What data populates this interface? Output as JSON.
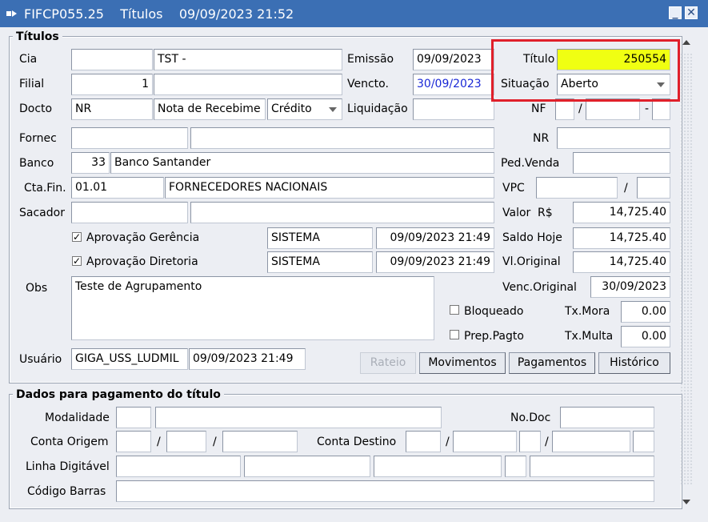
{
  "window": {
    "title": "FIFCP055.25    Títulos    09/09/2023 21:52"
  },
  "icons": [
    "app-icon",
    "minimize-icon",
    "close-icon",
    "check-icon",
    "dropdown-arrow-icon",
    "scroll-up-icon",
    "scroll-down-icon"
  ],
  "titulos": {
    "section_title": "Títulos",
    "cia": {
      "label": "Cia",
      "code": "",
      "name": "TST -"
    },
    "filial": {
      "label": "Filial",
      "code": "1",
      "name": ""
    },
    "docto": {
      "label": "Docto",
      "code": "NR",
      "name": "Nota de Recebime",
      "tipo": "Crédito"
    },
    "fornec": {
      "label": "Fornec",
      "code": "",
      "name": ""
    },
    "banco": {
      "label": "Banco",
      "code": "33",
      "name": "Banco Santander"
    },
    "cta_fin": {
      "label": "Cta.Fin.",
      "code": "01.01",
      "name": "FORNECEDORES NACIONAIS"
    },
    "sacador": {
      "label": "Sacador",
      "code": "",
      "name": ""
    },
    "emissao": {
      "label": "Emissão",
      "value": "09/09/2023"
    },
    "vencto": {
      "label": "Vencto.",
      "value": "30/09/2023"
    },
    "liquidacao": {
      "label": "Liquidação",
      "value": ""
    },
    "titulo": {
      "label": "Título",
      "value": "250554"
    },
    "situacao": {
      "label": "Situação",
      "value": "Aberto"
    },
    "nf": {
      "label": "NF",
      "sep1": "/",
      "sep2": "-"
    },
    "nr": {
      "label": "NR",
      "value": ""
    },
    "ped_venda": {
      "label": "Ped.Venda",
      "value": ""
    },
    "vpc": {
      "label": "VPC",
      "sep": "/"
    },
    "valor": {
      "label": "Valor",
      "currency": "R$",
      "value": "14,725.40"
    },
    "saldo_hoje": {
      "label": "Saldo Hoje",
      "value": "14,725.40"
    },
    "vl_original": {
      "label": "Vl.Original",
      "value": "14,725.40"
    },
    "venc_original": {
      "label": "Venc.Original",
      "value": "30/09/2023"
    },
    "aprov_gerencia": {
      "label": "Aprovação Gerência",
      "user": "SISTEMA",
      "date": "09/09/2023 21:49",
      "checked": true
    },
    "aprov_diretoria": {
      "label": "Aprovação Diretoria",
      "user": "SISTEMA",
      "date": "09/09/2023 21:49",
      "checked": true
    },
    "obs": {
      "label": "Obs",
      "value": "Teste de Agrupamento"
    },
    "bloqueado": {
      "label": "Bloqueado",
      "checked": false
    },
    "prep_pagto": {
      "label": "Prep.Pagto",
      "checked": false
    },
    "tx_mora": {
      "label": "Tx.Mora",
      "value": "0.00"
    },
    "tx_multa": {
      "label": "Tx.Multa",
      "value": "0.00"
    },
    "usuario": {
      "label": "Usuário",
      "value": "GIGA_USS_LUDMIL",
      "date": "09/09/2023 21:49"
    },
    "buttons": {
      "rateio": "Rateio",
      "movimentos": "Movimentos",
      "pagamentos": "Pagamentos",
      "historico": "Histórico"
    }
  },
  "pagamento": {
    "section_title": "Dados para pagamento do título",
    "modalidade": {
      "label": "Modalidade"
    },
    "no_doc": {
      "label": "No.Doc"
    },
    "conta_origem": {
      "label": "Conta Origem",
      "sep": "/"
    },
    "conta_destino": {
      "label": "Conta Destino",
      "sep": "/"
    },
    "linha_digitavel": {
      "label": "Linha Digitável"
    },
    "codigo_barras": {
      "label": "Código Barras"
    }
  },
  "colors": {
    "titlebar": "#3b6fb4",
    "highlight": "#f0ff12",
    "callout": "#e0202a",
    "blue_text": "#1a28d6"
  }
}
